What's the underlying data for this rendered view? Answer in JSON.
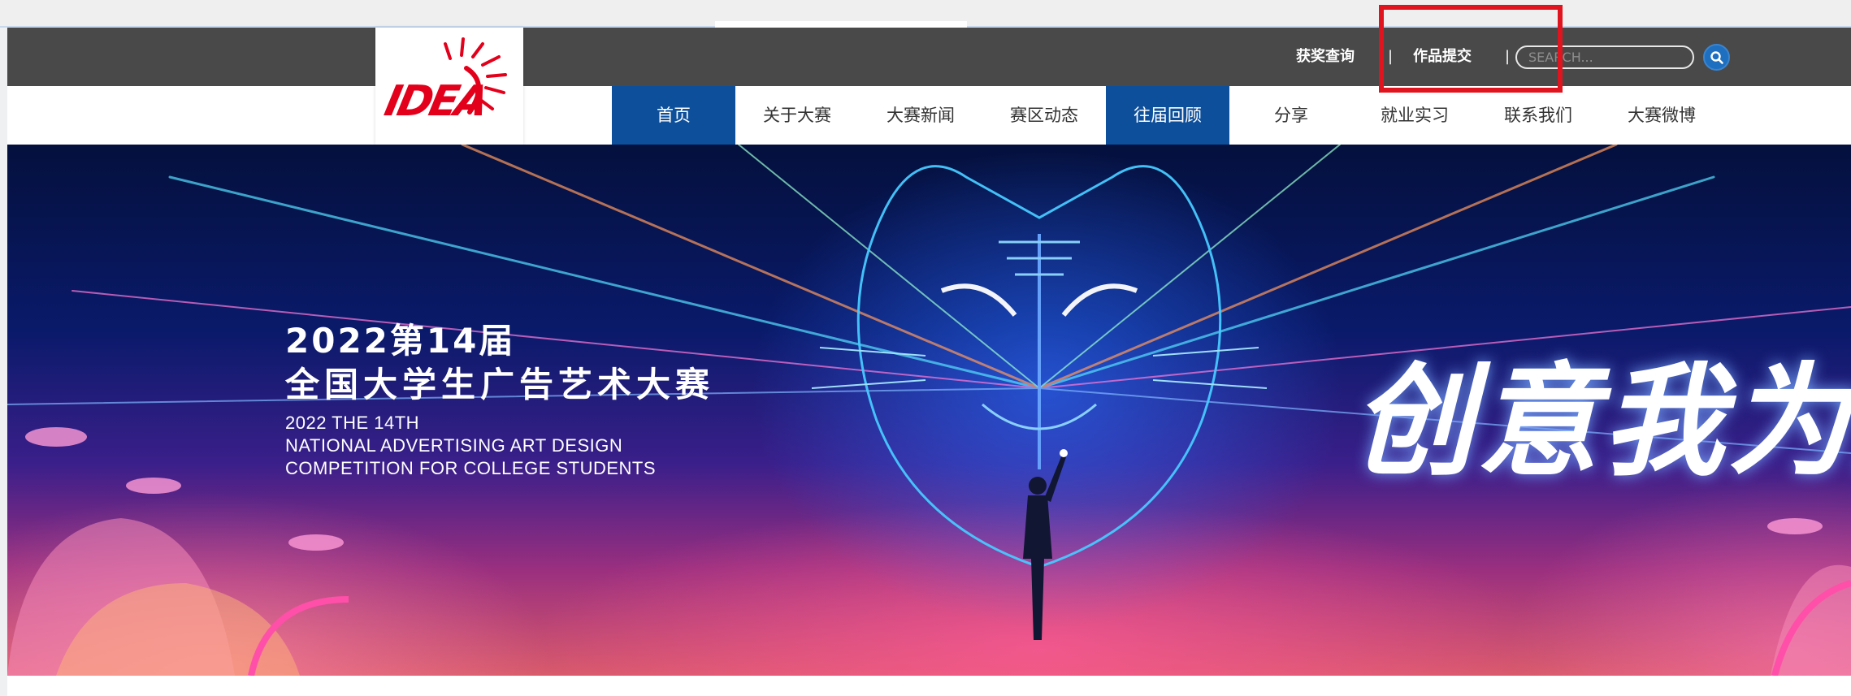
{
  "topbar": {
    "award_query": "获奖查询",
    "separator": "|",
    "work_submit": "作品提交",
    "separator2": "|",
    "search_placeholder": "SEARCH...",
    "search_icon": "search-icon"
  },
  "logo": {
    "text": "IDEA",
    "colors": {
      "red": "#e3001b"
    }
  },
  "nav": {
    "items": [
      {
        "label": "首页",
        "active": true
      },
      {
        "label": "关于大赛",
        "active": false
      },
      {
        "label": "大赛新闻",
        "active": false
      },
      {
        "label": "赛区动态",
        "active": false
      },
      {
        "label": "往届回顾",
        "active": true
      },
      {
        "label": "分享",
        "active": false
      },
      {
        "label": "就业实习",
        "active": false
      },
      {
        "label": "联系我们",
        "active": false
      },
      {
        "label": "大赛微博",
        "active": false
      }
    ],
    "active_color": "#0d4f9a"
  },
  "banner": {
    "year_line": "2022第14届",
    "title_line": "全国大学生广告艺术大赛",
    "en_line1": "2022 THE 14TH",
    "en_line2": "NATIONAL ADVERTISING ART DESIGN",
    "en_line3": "COMPETITION FOR COLLEGE STUDENTS",
    "slogan": "创意我为王"
  },
  "colors": {
    "topbar_bg": "#494949",
    "highlight": "#e0141e",
    "search_button": "#1e6fbf"
  }
}
